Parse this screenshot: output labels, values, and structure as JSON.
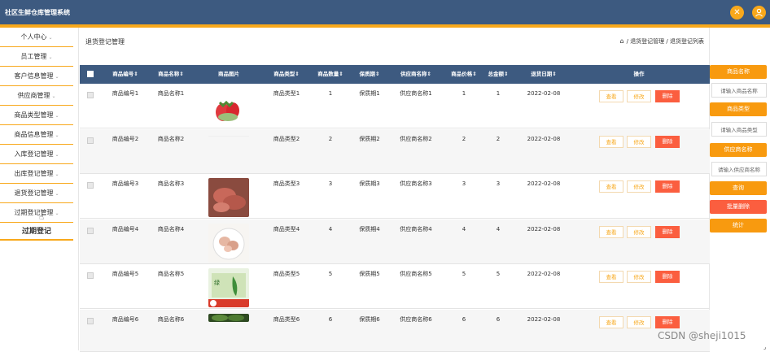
{
  "app": {
    "title": "社区生鲜仓库管理系统"
  },
  "header_icons": [
    "settings-icon",
    "user-icon"
  ],
  "colors": {
    "header": "#3d5a80",
    "accent": "#f8a81b",
    "danger": "#fb5e3f"
  },
  "sidebar": {
    "items": [
      {
        "label": "个人中心"
      },
      {
        "label": "员工管理"
      },
      {
        "label": "客户信息管理"
      },
      {
        "label": "供应商管理"
      },
      {
        "label": "商品类型管理"
      },
      {
        "label": "商品信息管理"
      },
      {
        "label": "入库登记管理"
      },
      {
        "label": "出库登记管理"
      },
      {
        "label": "退货登记管理"
      },
      {
        "label": "过期登记管理"
      }
    ],
    "sub_item": "过期登记"
  },
  "page": {
    "title": "退货登记管理",
    "breadcrumb": {
      "level1": "退货登记管理",
      "level2": "退货登记列表"
    }
  },
  "table": {
    "columns": [
      "商品编号",
      "商品名称",
      "商品图片",
      "商品类型",
      "商品数量",
      "保质期",
      "供应商名称",
      "商品价格",
      "总金额",
      "退货日期",
      "操作"
    ],
    "actions": {
      "view": "查看",
      "edit": "修改",
      "delete": "删除"
    },
    "rows": [
      {
        "id": "商品编号1",
        "name": "商品名称1",
        "image": "strawberry",
        "type": "商品类型1",
        "qty": "1",
        "shelf": "保质期1",
        "supplier": "供应商名称1",
        "price": "1",
        "total": "1",
        "date": "2022-02-08"
      },
      {
        "id": "商品编号2",
        "name": "商品名称2",
        "image": "none",
        "type": "商品类型2",
        "qty": "2",
        "shelf": "保质期2",
        "supplier": "供应商名称2",
        "price": "2",
        "total": "2",
        "date": "2022-02-08"
      },
      {
        "id": "商品编号3",
        "name": "商品名称3",
        "image": "meat",
        "type": "商品类型3",
        "qty": "3",
        "shelf": "保质期3",
        "supplier": "供应商名称3",
        "price": "3",
        "total": "3",
        "date": "2022-02-08"
      },
      {
        "id": "商品编号4",
        "name": "商品名称4",
        "image": "chicken",
        "type": "商品类型4",
        "qty": "4",
        "shelf": "保质期4",
        "supplier": "供应商名称4",
        "price": "4",
        "total": "4",
        "date": "2022-02-08"
      },
      {
        "id": "商品编号5",
        "name": "商品名称5",
        "image": "vegetable",
        "type": "商品类型5",
        "qty": "5",
        "shelf": "保质期5",
        "supplier": "供应商名称5",
        "price": "5",
        "total": "5",
        "date": "2022-02-08"
      },
      {
        "id": "商品编号6",
        "name": "商品名称6",
        "image": "greens",
        "type": "商品类型6",
        "qty": "6",
        "shelf": "保质期6",
        "supplier": "供应商名称6",
        "price": "6",
        "total": "6",
        "date": "2022-02-08"
      }
    ]
  },
  "filters": {
    "name_label": "商品名称",
    "name_placeholder": "请输入商品名称",
    "type_label": "商品类型",
    "type_placeholder": "请输入商品类型",
    "supplier_label": "供应商名称",
    "supplier_placeholder": "请输入供应商名称",
    "search_button": "查询",
    "batch_delete_button": "批量删除",
    "stats_button": "统计"
  },
  "watermark": "CSDN @sheji1015"
}
